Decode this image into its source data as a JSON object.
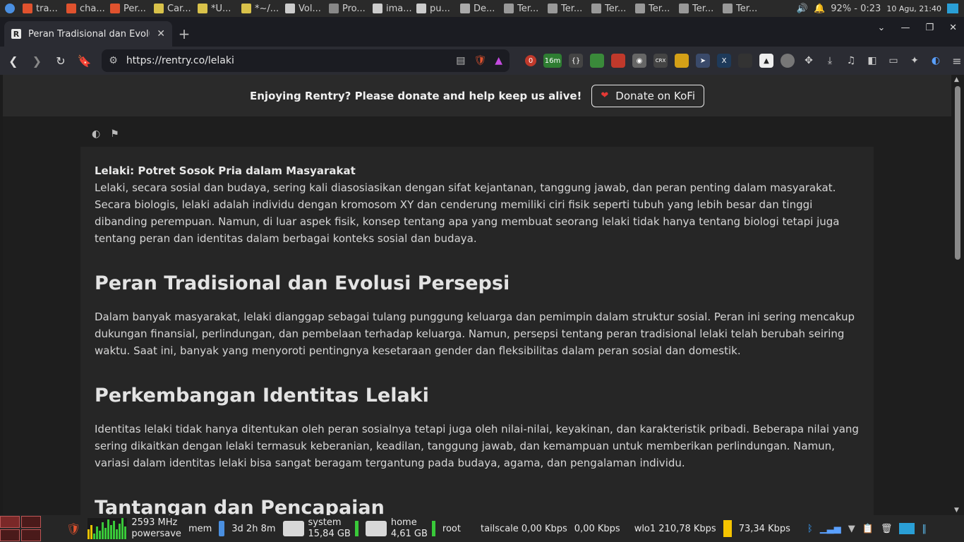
{
  "taskbar": {
    "tasks": [
      {
        "label": "tra...",
        "color": "#e0522e"
      },
      {
        "label": "cha...",
        "color": "#e0522e"
      },
      {
        "label": "Per...",
        "color": "#e0522e"
      },
      {
        "label": "Car...",
        "color": "#d9c24a"
      },
      {
        "label": "*U...",
        "color": "#d9c24a"
      },
      {
        "label": "*~/...",
        "color": "#d9c24a"
      },
      {
        "label": "Vol...",
        "color": "#cccccc"
      },
      {
        "label": "Pro...",
        "color": "#888888"
      },
      {
        "label": "ima...",
        "color": "#cccccc"
      },
      {
        "label": "pu...",
        "color": "#cccccc"
      },
      {
        "label": "De...",
        "color": "#aaaaaa"
      },
      {
        "label": "Ter...",
        "color": "#999999"
      },
      {
        "label": "Ter...",
        "color": "#999999"
      },
      {
        "label": "Ter...",
        "color": "#999999"
      },
      {
        "label": "Ter...",
        "color": "#999999"
      },
      {
        "label": "Ter...",
        "color": "#999999"
      },
      {
        "label": "Ter...",
        "color": "#999999"
      }
    ],
    "battery": "92% - 0:23",
    "clock": "10 Agu, 21:40"
  },
  "browser": {
    "tab_title": "Peran Tradisional dan Evolus",
    "favicon_letter": "R",
    "url": "https://rentry.co/lelaki",
    "ext_badge_count": "0",
    "ext_timer": "16m"
  },
  "page": {
    "banner_text": "Enjoying Rentry? Please donate and help keep us alive!",
    "donate_label": "Donate on KoFi",
    "intro_title": "Lelaki: Potret Sosok Pria dalam Masyarakat",
    "intro_text": "Lelaki, secara sosial dan budaya, sering kali diasosiasikan dengan sifat kejantanan, tanggung jawab, dan peran penting dalam masyarakat. Secara biologis, lelaki adalah individu dengan kromosom XY dan cenderung memiliki ciri fisik seperti tubuh yang lebih besar dan tinggi dibanding perempuan. Namun, di luar aspek fisik, konsep tentang apa yang membuat seorang lelaki tidak hanya tentang biologi tetapi juga tentang peran dan identitas dalam berbagai konteks sosial dan budaya.",
    "sections": [
      {
        "heading": "Peran Tradisional dan Evolusi Persepsi",
        "text": "Dalam banyak masyarakat, lelaki dianggap sebagai tulang punggung keluarga dan pemimpin dalam struktur sosial. Peran ini sering mencakup dukungan finansial, perlindungan, dan pembelaan terhadap keluarga. Namun, persepsi tentang peran tradisional lelaki telah berubah seiring waktu. Saat ini, banyak yang menyoroti pentingnya kesetaraan gender dan fleksibilitas dalam peran sosial dan domestik."
      },
      {
        "heading": "Perkembangan Identitas Lelaki",
        "text": "Identitas lelaki tidak hanya ditentukan oleh peran sosialnya tetapi juga oleh nilai-nilai, keyakinan, dan karakteristik pribadi. Beberapa nilai yang sering dikaitkan dengan lelaki termasuk keberanian, keadilan, tanggung jawab, dan kemampuan untuk memberikan perlindungan. Namun, variasi dalam identitas lelaki bisa sangat beragam tergantung pada budaya, agama, dan pengalaman individu."
      },
      {
        "heading": "Tantangan dan Pencapaian",
        "text": ""
      }
    ]
  },
  "bottom_panel": {
    "cpu_freq": "2593 MHz",
    "cpu_gov": "powersave",
    "mem_label": "mem",
    "uptime": "3d 2h 8m",
    "disk1_label": "system",
    "disk1_size": "15,84 GB",
    "disk2_label": "home",
    "disk2_size": "4,61 GB",
    "root_label": "root",
    "tailscale": "tailscale 0,00 Kbps",
    "tailscale2": "0,00 Kbps",
    "wlan_down": "wlo1 210,78 Kbps",
    "wlan_up": "73,34 Kbps"
  }
}
